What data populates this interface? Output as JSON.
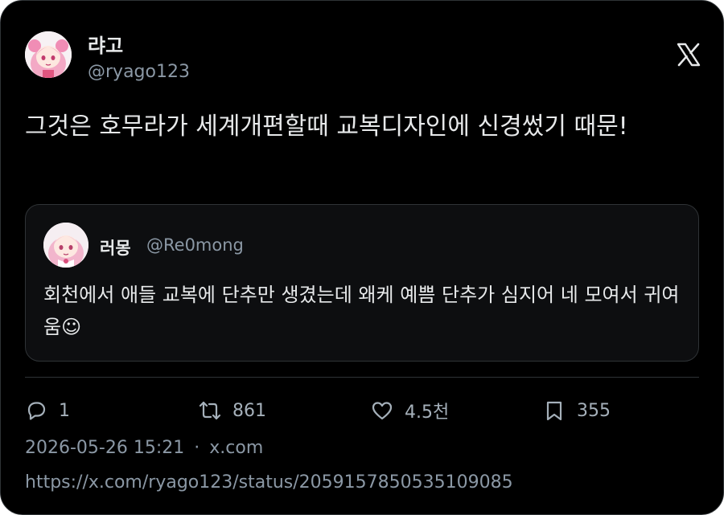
{
  "author": {
    "display_name": "랴고",
    "handle": "@ryago123"
  },
  "tweet": {
    "text": "그것은 호무라가 세계개편할때 교복디자인에 신경썼기 때문!"
  },
  "quote": {
    "display_name": "러몽",
    "handle": "@Re0mong",
    "text": "회천에서 애들 교복에 단추만 생겼는데 왜케 예쁨 단추가 심지어 네 모여서 귀여움☺"
  },
  "actions": {
    "replies": "1",
    "retweets": "861",
    "likes": "4.5천",
    "bookmarks": "355"
  },
  "meta": {
    "timestamp": "2026-05-26 15:21",
    "separator": "·",
    "source": "x.com"
  },
  "url": "https://x.com/ryago123/status/2059157850535109085",
  "colors": {
    "background": "#000000",
    "text": "#e7e9ea",
    "secondary": "#8b98a5",
    "border": "#2f3336"
  }
}
